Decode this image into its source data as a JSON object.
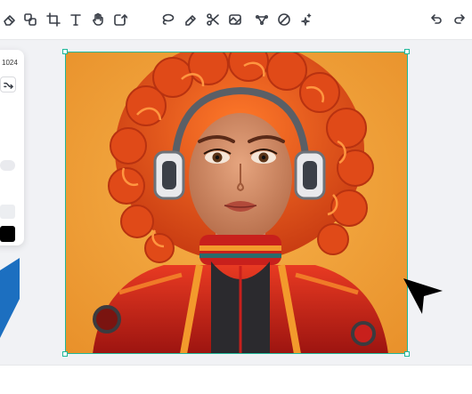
{
  "toolbar": {
    "left_tools": [
      {
        "icon": "eraser-icon",
        "name": "eraser-tool"
      },
      {
        "icon": "layers-icon",
        "name": "layers-tool"
      },
      {
        "icon": "crop-icon",
        "name": "crop-tool"
      },
      {
        "icon": "text-icon",
        "name": "text-tool"
      },
      {
        "icon": "hand-icon",
        "name": "pan-tool"
      },
      {
        "icon": "upload-icon",
        "name": "upload-tool"
      }
    ],
    "center_tools": [
      {
        "icon": "lasso-icon",
        "name": "lasso-tool"
      },
      {
        "icon": "brush-icon",
        "name": "brush-tool"
      },
      {
        "icon": "scissors-icon",
        "name": "cut-tool"
      },
      {
        "icon": "background-remove-icon",
        "name": "remove-background-tool"
      },
      {
        "icon": "magic-select-icon",
        "name": "magic-select-tool"
      },
      {
        "icon": "no-icon",
        "name": "disable-tool"
      },
      {
        "icon": "sparkle-icon",
        "name": "ai-enhance-tool"
      }
    ],
    "right_tools": [
      {
        "icon": "undo-icon",
        "name": "undo-button"
      },
      {
        "icon": "redo-icon",
        "name": "redo-button"
      }
    ]
  },
  "left_panel": {
    "size_label": "1024"
  },
  "colors": {
    "selection": "#1fb89a",
    "background_orange": "#f0a035",
    "hair": "#e4511c",
    "suit_red": "#c8201c"
  }
}
